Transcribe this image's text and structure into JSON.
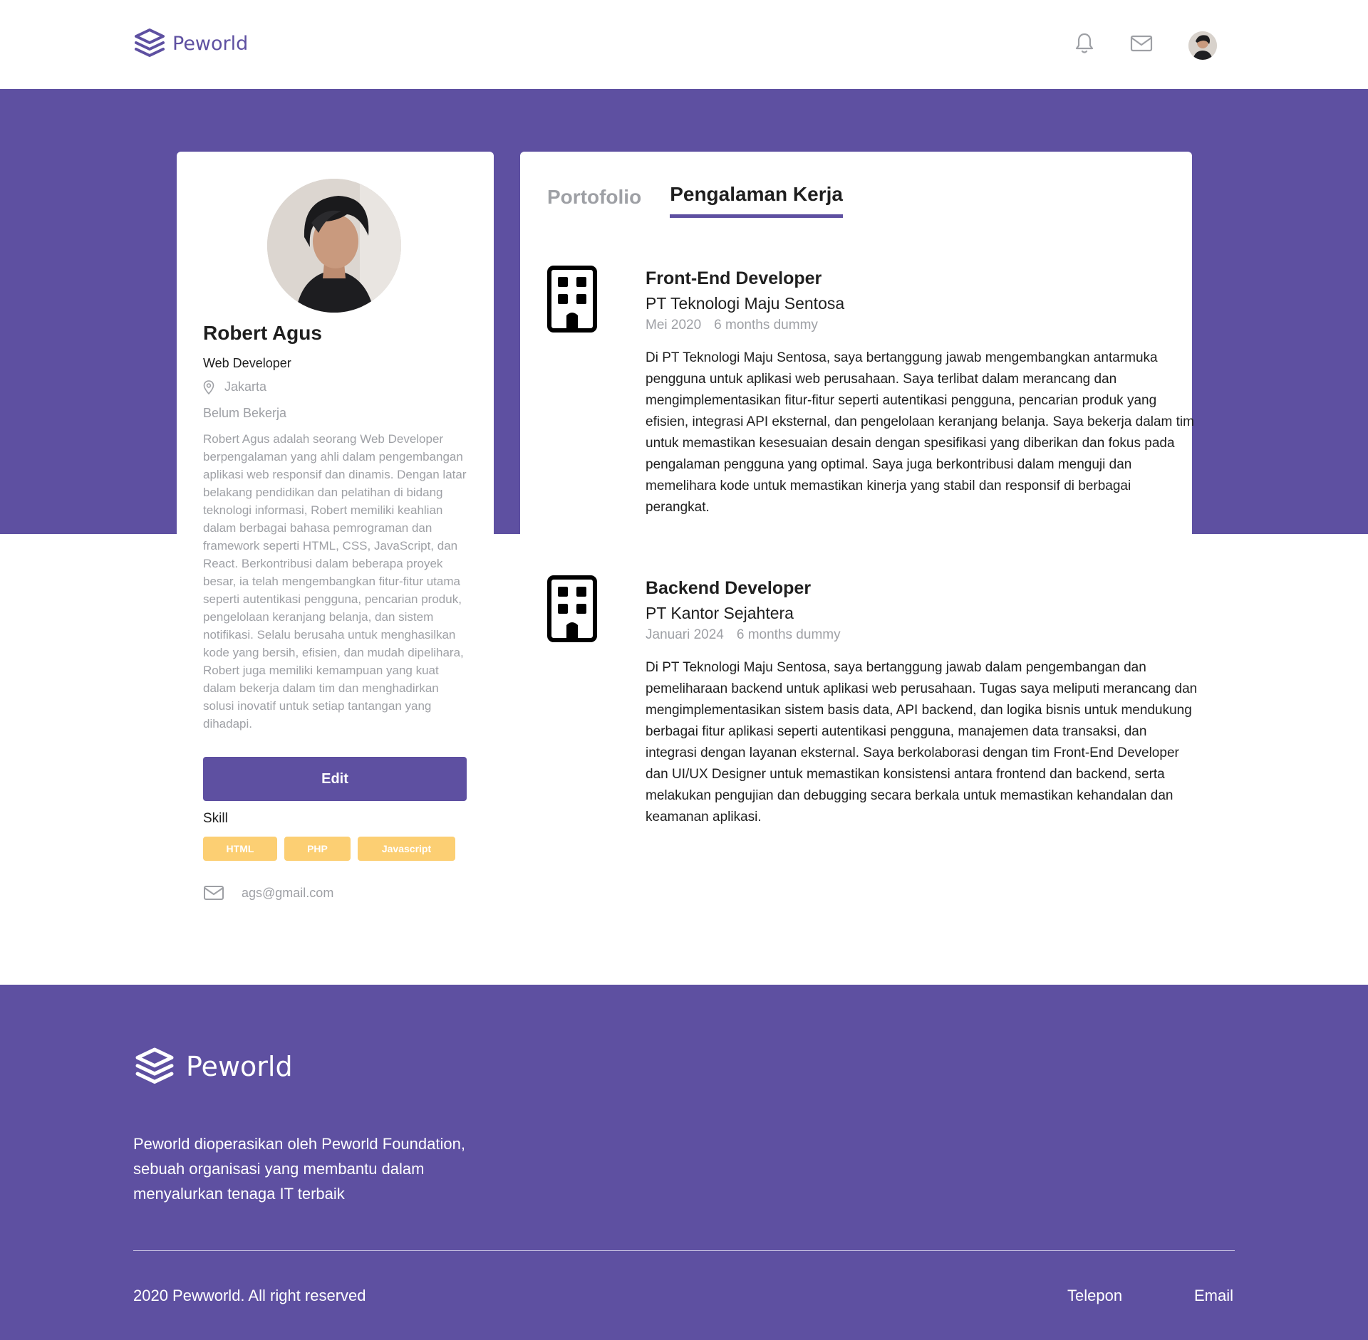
{
  "brand": {
    "name": "Peworld",
    "color": "#5e50a1"
  },
  "nav": {
    "icons": [
      "bell-icon",
      "mail-icon"
    ],
    "avatar_alt": "user avatar"
  },
  "profile": {
    "name": "Robert Agus",
    "role": "Web Developer",
    "location": "Jakarta",
    "status": "Belum Bekerja",
    "bio": "Robert Agus adalah seorang Web Developer berpengalaman yang ahli dalam pengembangan aplikasi web responsif dan dinamis. Dengan latar belakang pendidikan dan pelatihan di bidang teknologi informasi, Robert memiliki keahlian dalam berbagai bahasa pemrograman dan framework seperti HTML, CSS, JavaScript, dan React. Berkontribusi dalam beberapa proyek besar, ia telah mengembangkan fitur-fitur utama seperti autentikasi pengguna, pencarian produk, pengelolaan keranjang belanja, dan sistem notifikasi. Selalu berusaha untuk menghasilkan kode yang bersih, efisien, dan mudah dipelihara, Robert juga memiliki kemampuan yang kuat dalam bekerja dalam tim dan menghadirkan solusi inovatif untuk setiap tantangan yang dihadapi.",
    "edit_label": "Edit",
    "skill_title": "Skill",
    "skills": [
      "HTML",
      "PHP",
      "Javascript"
    ],
    "email": "ags@gmail.com"
  },
  "tabs": [
    {
      "label": "Portofolio",
      "active": false
    },
    {
      "label": "Pengalaman Kerja",
      "active": true
    }
  ],
  "experience": [
    {
      "title": "Front-End Developer",
      "company": "PT Teknologi Maju Sentosa",
      "date": "Mei 2020",
      "duration": "6 months dummy",
      "description": "Di PT Teknologi Maju Sentosa, saya bertanggung jawab mengembangkan antarmuka pengguna untuk aplikasi web perusahaan. Saya terlibat dalam merancang dan mengimplementasikan fitur-fitur seperti autentikasi pengguna, pencarian produk yang efisien, integrasi API eksternal, dan pengelolaan keranjang belanja. Saya bekerja dalam tim untuk memastikan kesesuaian desain dengan spesifikasi yang diberikan dan fokus pada pengalaman pengguna yang optimal. Saya juga berkontribusi dalam menguji dan memelihara kode untuk memastikan kinerja yang stabil dan responsif di berbagai perangkat."
    },
    {
      "title": "Backend Developer",
      "company": "PT Kantor Sejahtera",
      "date": "Januari 2024",
      "duration": "6 months dummy",
      "description": "Di PT Teknologi Maju Sentosa, saya bertanggung jawab dalam pengembangan dan pemeliharaan backend untuk aplikasi web perusahaan. Tugas saya meliputi merancang dan mengimplementasikan sistem basis data, API backend, dan logika bisnis untuk mendukung berbagai fitur aplikasi seperti autentikasi pengguna, manajemen data transaksi, dan integrasi dengan layanan eksternal. Saya berkolaborasi dengan tim Front-End Developer dan UI/UX Designer untuk memastikan konsistensi antara frontend dan backend, serta melakukan pengujian dan debugging secara berkala untuk memastikan kehandalan dan keamanan aplikasi."
    }
  ],
  "footer": {
    "brand": "Peworld",
    "description": "Peworld dioperasikan oleh Peworld Foundation, sebuah organisasi yang membantu dalam menyalurkan tenaga IT terbaik",
    "copyright": "2020 Pewworld. All right reserved",
    "links": [
      "Telepon",
      "Email"
    ]
  },
  "colors": {
    "primary": "#5e50a1",
    "skill_tag": "#fbb017",
    "muted_text": "#9ea0a5"
  }
}
